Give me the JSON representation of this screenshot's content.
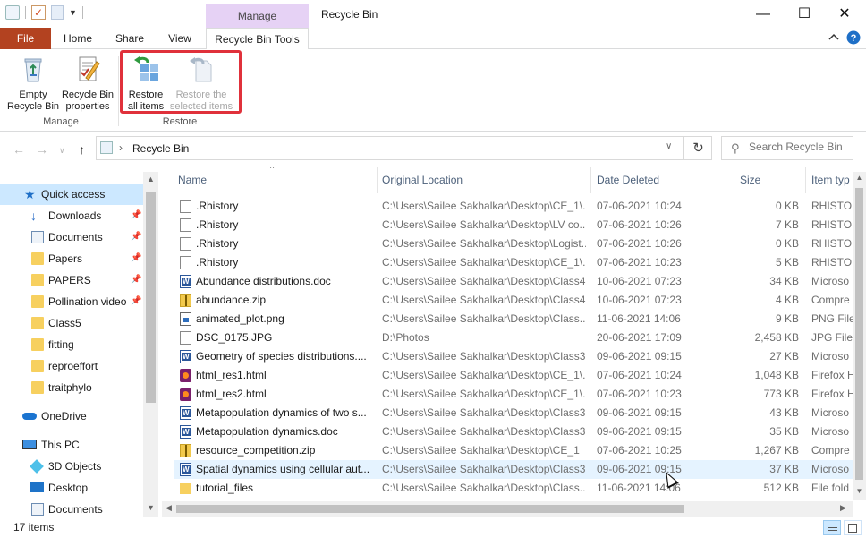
{
  "window": {
    "title": "Recycle Bin",
    "context_tab": "Manage",
    "minimize_icon": "minimize-icon",
    "maximize_icon": "maximize-icon",
    "close_icon": "close-icon"
  },
  "ribbon": {
    "tabs": [
      {
        "label": "File"
      },
      {
        "label": "Home"
      },
      {
        "label": "Share"
      },
      {
        "label": "View"
      },
      {
        "label": "Recycle Bin Tools"
      }
    ],
    "groups": [
      {
        "label": "Manage",
        "buttons": [
          {
            "label_line1": "Empty",
            "label_line2": "Recycle Bin",
            "icon": "recycle-bin-icon"
          },
          {
            "label_line1": "Recycle Bin",
            "label_line2": "properties",
            "icon": "properties-icon"
          }
        ]
      },
      {
        "label": "Restore",
        "buttons": [
          {
            "label_line1": "Restore",
            "label_line2": "all items",
            "icon": "restore-all-icon",
            "enabled": true
          },
          {
            "label_line1": "Restore the",
            "label_line2": "selected items",
            "icon": "restore-selected-icon",
            "enabled": false
          }
        ]
      }
    ],
    "highlight_color": "#e0313b"
  },
  "address": {
    "breadcrumb": "Recycle Bin",
    "search_placeholder": "Search Recycle Bin"
  },
  "sidebar": {
    "items": [
      {
        "label": "Quick access",
        "icon": "star-icon",
        "pinned": false
      },
      {
        "label": "Downloads",
        "icon": "download-icon",
        "pinned": true
      },
      {
        "label": "Documents",
        "icon": "documents-icon",
        "pinned": true
      },
      {
        "label": "Papers",
        "icon": "folder-icon",
        "pinned": true
      },
      {
        "label": "PAPERS",
        "icon": "folder-icon",
        "pinned": true
      },
      {
        "label": "Pollination video",
        "icon": "folder-icon",
        "pinned": true
      },
      {
        "label": "Class5",
        "icon": "folder-icon",
        "pinned": false
      },
      {
        "label": "fitting",
        "icon": "folder-icon",
        "pinned": false
      },
      {
        "label": "reproeffort",
        "icon": "folder-icon",
        "pinned": false
      },
      {
        "label": "traitphylo",
        "icon": "folder-icon",
        "pinned": false
      },
      {
        "label": "OneDrive",
        "icon": "cloud-icon",
        "pinned": false
      },
      {
        "label": "This PC",
        "icon": "computer-icon",
        "pinned": false
      },
      {
        "label": "3D Objects",
        "icon": "cube-icon",
        "pinned": false
      },
      {
        "label": "Desktop",
        "icon": "desktop-icon",
        "pinned": false
      },
      {
        "label": "Documents",
        "icon": "documents-icon",
        "pinned": false
      }
    ]
  },
  "filelist": {
    "columns": [
      "Name",
      "Original Location",
      "Date Deleted",
      "Size",
      "Item typ"
    ],
    "rows": [
      {
        "name": ".Rhistory",
        "loc": "C:\\Users\\Sailee Sakhalkar\\Desktop\\CE_1\\...",
        "date": "07-06-2021 10:24",
        "size": "0 KB",
        "type": "RHISTOR",
        "icon": "blank"
      },
      {
        "name": ".Rhistory",
        "loc": "C:\\Users\\Sailee Sakhalkar\\Desktop\\LV co...",
        "date": "07-06-2021 10:26",
        "size": "7 KB",
        "type": "RHISTOR",
        "icon": "blank"
      },
      {
        "name": ".Rhistory",
        "loc": "C:\\Users\\Sailee Sakhalkar\\Desktop\\Logist...",
        "date": "07-06-2021 10:26",
        "size": "0 KB",
        "type": "RHISTOR",
        "icon": "blank"
      },
      {
        "name": ".Rhistory",
        "loc": "C:\\Users\\Sailee Sakhalkar\\Desktop\\CE_1\\...",
        "date": "07-06-2021 10:23",
        "size": "5 KB",
        "type": "RHISTOR",
        "icon": "blank"
      },
      {
        "name": "Abundance distributions.doc",
        "loc": "C:\\Users\\Sailee Sakhalkar\\Desktop\\Class4",
        "date": "10-06-2021 07:23",
        "size": "34 KB",
        "type": "Microso",
        "icon": "doc"
      },
      {
        "name": "abundance.zip",
        "loc": "C:\\Users\\Sailee Sakhalkar\\Desktop\\Class4",
        "date": "10-06-2021 07:23",
        "size": "4 KB",
        "type": "Compre",
        "icon": "zip"
      },
      {
        "name": "animated_plot.png",
        "loc": "C:\\Users\\Sailee Sakhalkar\\Desktop\\Class...",
        "date": "11-06-2021 14:06",
        "size": "9 KB",
        "type": "PNG File",
        "icon": "png"
      },
      {
        "name": "DSC_0175.JPG",
        "loc": "D:\\Photos",
        "date": "20-06-2021 17:09",
        "size": "2,458 KB",
        "type": "JPG File",
        "icon": "blank"
      },
      {
        "name": "Geometry of species distributions....",
        "loc": "C:\\Users\\Sailee Sakhalkar\\Desktop\\Class3",
        "date": "09-06-2021 09:15",
        "size": "27 KB",
        "type": "Microso",
        "icon": "doc"
      },
      {
        "name": "html_res1.html",
        "loc": "C:\\Users\\Sailee Sakhalkar\\Desktop\\CE_1\\...",
        "date": "07-06-2021 10:24",
        "size": "1,048 KB",
        "type": "Firefox H",
        "icon": "html"
      },
      {
        "name": "html_res2.html",
        "loc": "C:\\Users\\Sailee Sakhalkar\\Desktop\\CE_1\\...",
        "date": "07-06-2021 10:23",
        "size": "773 KB",
        "type": "Firefox H",
        "icon": "html"
      },
      {
        "name": "Metapopulation dynamics of two s...",
        "loc": "C:\\Users\\Sailee Sakhalkar\\Desktop\\Class3",
        "date": "09-06-2021 09:15",
        "size": "43 KB",
        "type": "Microso",
        "icon": "doc"
      },
      {
        "name": "Metapopulation dynamics.doc",
        "loc": "C:\\Users\\Sailee Sakhalkar\\Desktop\\Class3",
        "date": "09-06-2021 09:15",
        "size": "35 KB",
        "type": "Microso",
        "icon": "doc"
      },
      {
        "name": "resource_competition.zip",
        "loc": "C:\\Users\\Sailee Sakhalkar\\Desktop\\CE_1",
        "date": "07-06-2021 10:25",
        "size": "1,267 KB",
        "type": "Compre",
        "icon": "zip"
      },
      {
        "name": "Spatial dynamics using cellular aut...",
        "loc": "C:\\Users\\Sailee Sakhalkar\\Desktop\\Class3",
        "date": "09-06-2021 09:15",
        "size": "37 KB",
        "type": "Microso",
        "icon": "doc",
        "hover": true
      },
      {
        "name": "tutorial_files",
        "loc": "C:\\Users\\Sailee Sakhalkar\\Desktop\\Class...",
        "date": "11-06-2021 14:06",
        "size": "512 KB",
        "type": "File fold",
        "icon": "folder"
      }
    ]
  },
  "status": {
    "item_count": "17 items"
  }
}
